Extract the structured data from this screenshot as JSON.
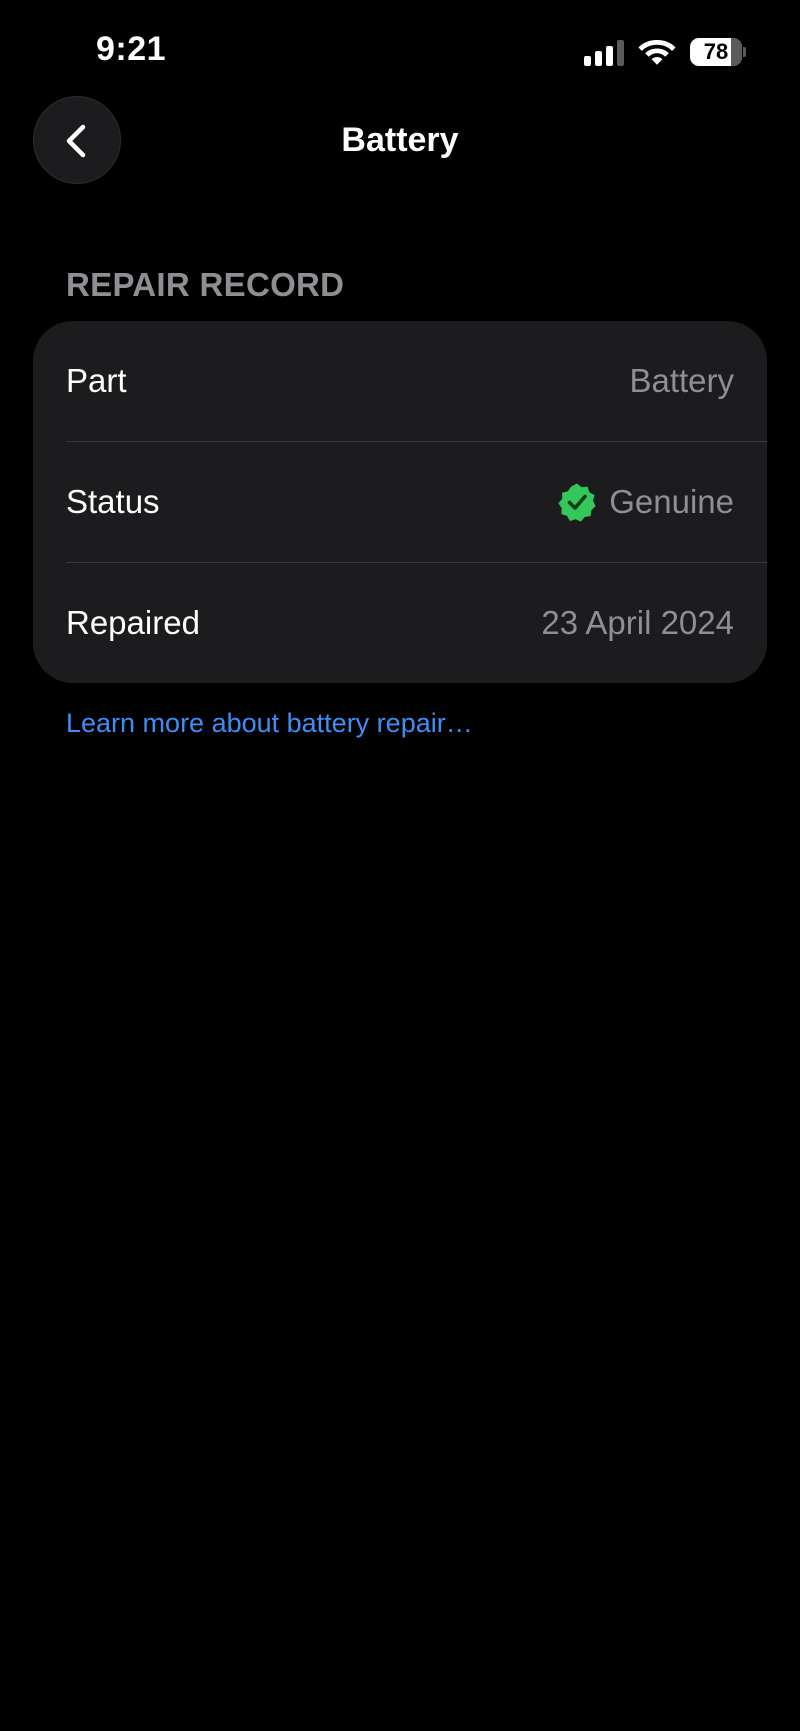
{
  "status_bar": {
    "time": "9:21",
    "battery_level": "78",
    "battery_fraction": 0.78,
    "icons": [
      "signal-icon",
      "wifi-icon",
      "battery-icon"
    ]
  },
  "nav": {
    "title": "Battery",
    "back_icon": "chevron-left-icon"
  },
  "section": {
    "header": "REPAIR RECORD",
    "rows": [
      {
        "label": "Part",
        "value": "Battery"
      },
      {
        "label": "Status",
        "value": "Genuine",
        "icon": "verified-check-icon"
      },
      {
        "label": "Repaired",
        "value": "23 April 2024"
      }
    ]
  },
  "link": {
    "text": "Learn more about battery repair…"
  },
  "colors": {
    "background": "#000000",
    "card": "#1c1c1e",
    "secondary_text": "#8e8e93",
    "link": "#3e8ef7",
    "verified_green": "#34c759"
  }
}
